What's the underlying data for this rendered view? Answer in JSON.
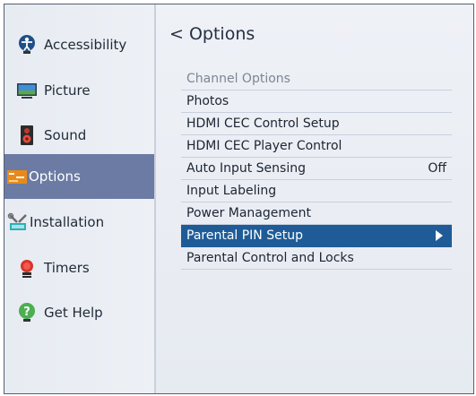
{
  "sidebar": {
    "items": [
      {
        "label": "Accessibility",
        "icon": "accessibility-icon"
      },
      {
        "label": "Picture",
        "icon": "picture-icon"
      },
      {
        "label": "Sound",
        "icon": "sound-icon"
      },
      {
        "label": "Options",
        "icon": "options-icon",
        "selected": true
      },
      {
        "label": "Installation",
        "icon": "installation-icon"
      },
      {
        "label": "Timers",
        "icon": "timers-icon"
      },
      {
        "label": "Get Help",
        "icon": "get-help-icon"
      }
    ],
    "selected_color": "#6b7ba3"
  },
  "main": {
    "back_title": "< Options",
    "menu": [
      {
        "label": "Channel Options",
        "disabled": true
      },
      {
        "label": "Photos"
      },
      {
        "label": "HDMI CEC Control Setup"
      },
      {
        "label": "HDMI CEC Player Control"
      },
      {
        "label": "Auto Input Sensing",
        "value": "Off"
      },
      {
        "label": "Input Labeling"
      },
      {
        "label": "Power Management"
      },
      {
        "label": "Parental PIN Setup",
        "highlighted": true
      },
      {
        "label": "Parental Control and Locks"
      }
    ],
    "highlight_color": "#1f5c97"
  }
}
